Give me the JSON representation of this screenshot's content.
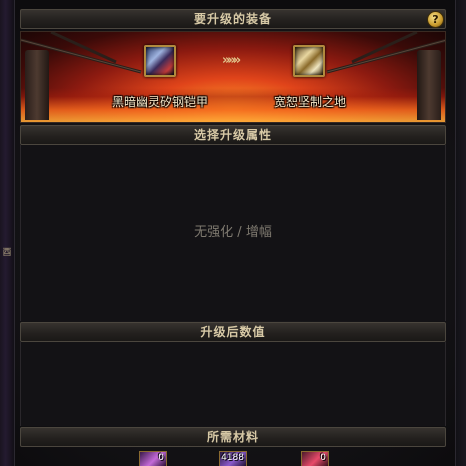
{
  "header": {
    "title": "要升级的装备",
    "help_label": "?"
  },
  "banner": {
    "source_item_name": "黑暗幽灵矽钢铠甲",
    "target_item_name": "宽恕坚制之地",
    "arrow": "»»»"
  },
  "attributes": {
    "title": "选择升级属性",
    "empty_text": "无强化 / 增幅"
  },
  "result": {
    "title": "升级后数值"
  },
  "materials": {
    "title": "所需材料",
    "items": [
      {
        "count": "0",
        "icon": "purple-crystal-icon"
      },
      {
        "count": "4188",
        "icon": "violet-essence-icon"
      },
      {
        "count": "0",
        "icon": "red-crystal-icon"
      }
    ]
  },
  "side": {
    "mark": "酉"
  },
  "colors": {
    "bar_text": "#d7c9a6",
    "item_frame": "#b08a3e",
    "lava": "#e0441a"
  }
}
